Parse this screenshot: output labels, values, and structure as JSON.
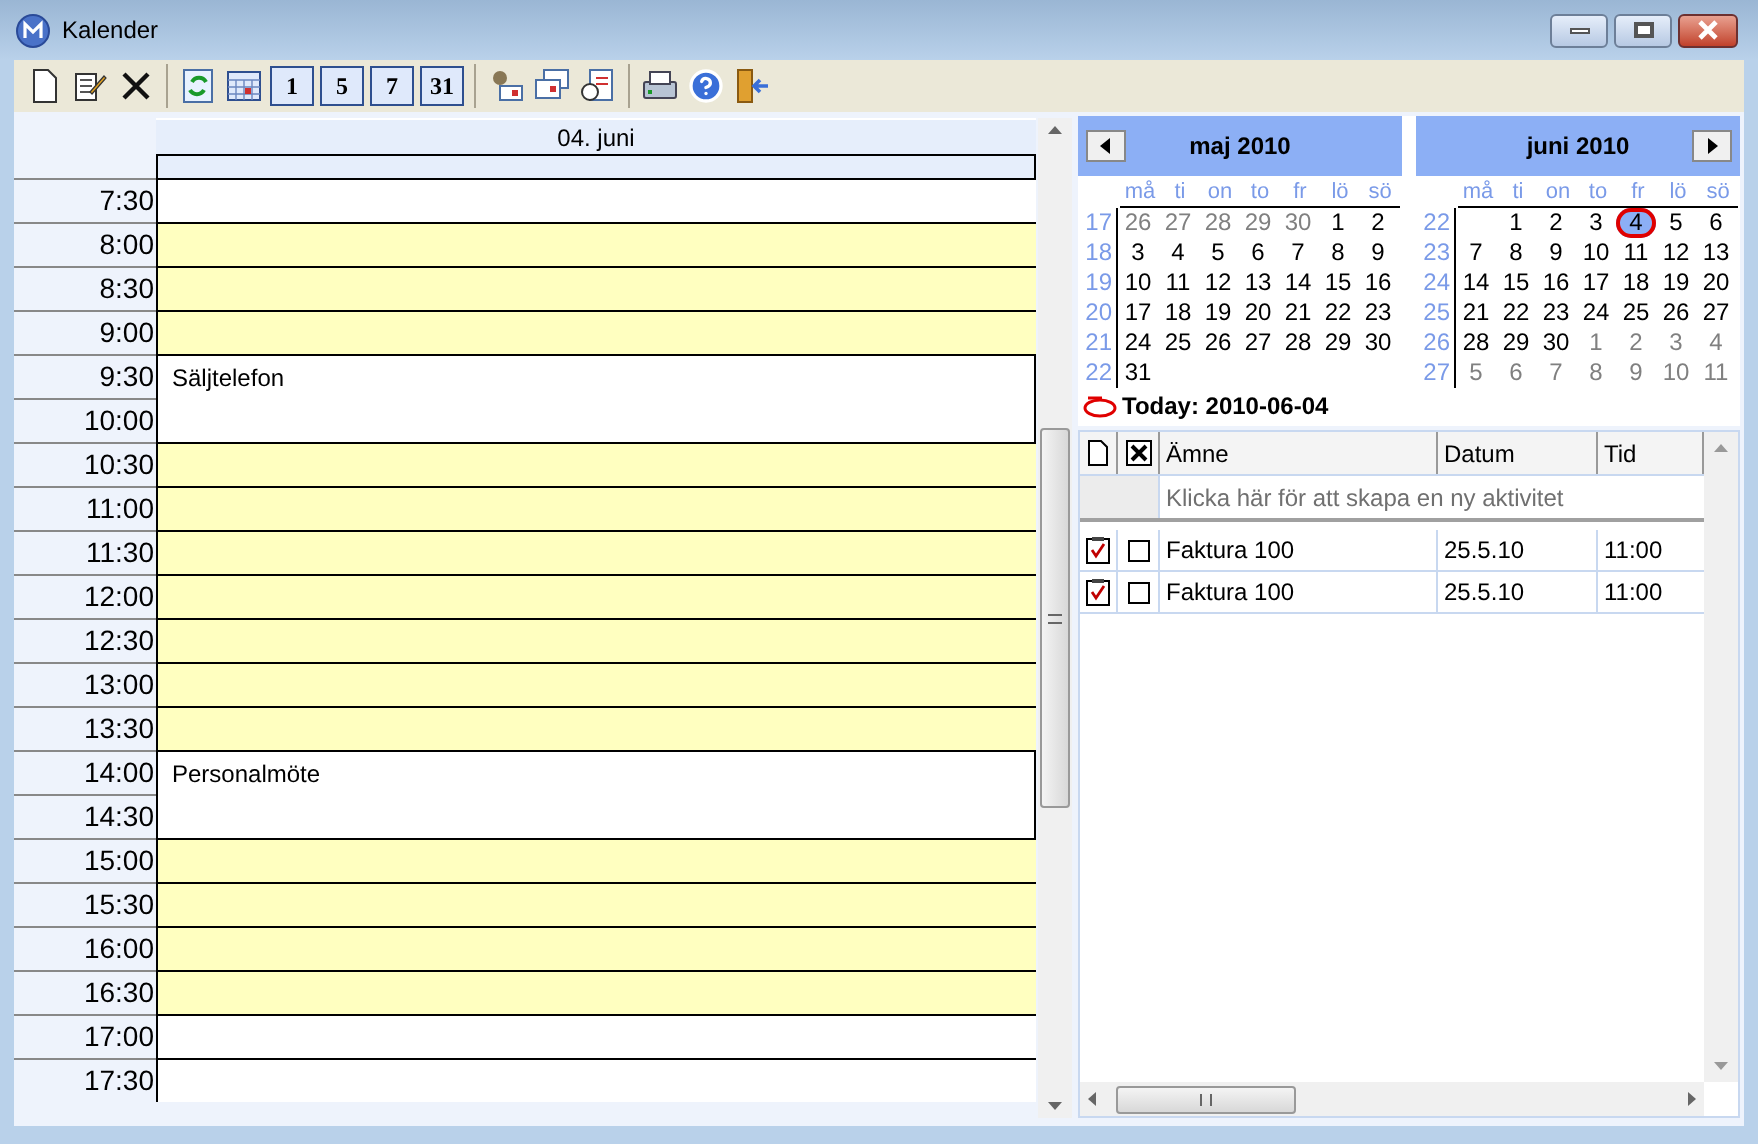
{
  "window": {
    "title": "Kalender"
  },
  "toolbar": [
    {
      "kind": "new"
    },
    {
      "kind": "edit"
    },
    {
      "kind": "delete"
    },
    {
      "kind": "separator"
    },
    {
      "kind": "refresh"
    },
    {
      "kind": "grid"
    },
    {
      "kind": "numbered",
      "label": "1"
    },
    {
      "kind": "numbered",
      "label": "5"
    },
    {
      "kind": "numbered",
      "label": "7"
    },
    {
      "kind": "numbered",
      "label": "31"
    },
    {
      "kind": "separator"
    },
    {
      "kind": "person"
    },
    {
      "kind": "windows"
    },
    {
      "kind": "clock"
    },
    {
      "kind": "separator"
    },
    {
      "kind": "print"
    },
    {
      "kind": "help"
    },
    {
      "kind": "exit"
    }
  ],
  "day_view": {
    "header": "04. juni",
    "rows": [
      {
        "kind": "slot",
        "time": "7:30",
        "working": false
      },
      {
        "kind": "slot",
        "time": "8:00",
        "working": true
      },
      {
        "kind": "slot",
        "time": "8:30",
        "working": true
      },
      {
        "kind": "slot",
        "time": "9:00",
        "working": true
      },
      {
        "kind": "appointment",
        "times": [
          "9:30",
          "10:00"
        ],
        "title": "Säljtelefon"
      },
      {
        "kind": "slot",
        "time": "10:30",
        "working": true
      },
      {
        "kind": "slot",
        "time": "11:00",
        "working": true
      },
      {
        "kind": "slot",
        "time": "11:30",
        "working": true
      },
      {
        "kind": "slot",
        "time": "12:00",
        "working": true
      },
      {
        "kind": "slot",
        "time": "12:30",
        "working": true
      },
      {
        "kind": "slot",
        "time": "13:00",
        "working": true
      },
      {
        "kind": "slot",
        "time": "13:30",
        "working": true
      },
      {
        "kind": "appointment",
        "times": [
          "14:00",
          "14:30"
        ],
        "title": "Personalmöte"
      },
      {
        "kind": "slot",
        "time": "15:00",
        "working": true
      },
      {
        "kind": "slot",
        "time": "15:30",
        "working": true
      },
      {
        "kind": "slot",
        "time": "16:00",
        "working": true
      },
      {
        "kind": "slot",
        "time": "16:30",
        "working": true
      },
      {
        "kind": "slot",
        "time": "17:00",
        "working": false
      },
      {
        "kind": "slot",
        "time": "17:30",
        "working": false
      }
    ]
  },
  "calendars": [
    {
      "title": "maj 2010",
      "weekdays": [
        "må",
        "ti",
        "on",
        "to",
        "fr",
        "lö",
        "sö"
      ],
      "weeks": [
        {
          "week": "17",
          "days": [
            {
              "d": "26",
              "muted": true,
              "selected": false
            },
            {
              "d": "27",
              "muted": true,
              "selected": false
            },
            {
              "d": "28",
              "muted": true,
              "selected": false
            },
            {
              "d": "29",
              "muted": true,
              "selected": false
            },
            {
              "d": "30",
              "muted": true,
              "selected": false
            },
            {
              "d": "1",
              "muted": false,
              "selected": false
            },
            {
              "d": "2",
              "muted": false,
              "selected": false
            }
          ]
        },
        {
          "week": "18",
          "days": [
            {
              "d": "3",
              "muted": false,
              "selected": false
            },
            {
              "d": "4",
              "muted": false,
              "selected": false
            },
            {
              "d": "5",
              "muted": false,
              "selected": false
            },
            {
              "d": "6",
              "muted": false,
              "selected": false
            },
            {
              "d": "7",
              "muted": false,
              "selected": false
            },
            {
              "d": "8",
              "muted": false,
              "selected": false
            },
            {
              "d": "9",
              "muted": false,
              "selected": false
            }
          ]
        },
        {
          "week": "19",
          "days": [
            {
              "d": "10",
              "muted": false,
              "selected": false
            },
            {
              "d": "11",
              "muted": false,
              "selected": false
            },
            {
              "d": "12",
              "muted": false,
              "selected": false
            },
            {
              "d": "13",
              "muted": false,
              "selected": false
            },
            {
              "d": "14",
              "muted": false,
              "selected": false
            },
            {
              "d": "15",
              "muted": false,
              "selected": false
            },
            {
              "d": "16",
              "muted": false,
              "selected": false
            }
          ]
        },
        {
          "week": "20",
          "days": [
            {
              "d": "17",
              "muted": false,
              "selected": false
            },
            {
              "d": "18",
              "muted": false,
              "selected": false
            },
            {
              "d": "19",
              "muted": false,
              "selected": false
            },
            {
              "d": "20",
              "muted": false,
              "selected": false
            },
            {
              "d": "21",
              "muted": false,
              "selected": false
            },
            {
              "d": "22",
              "muted": false,
              "selected": false
            },
            {
              "d": "23",
              "muted": false,
              "selected": false
            }
          ]
        },
        {
          "week": "21",
          "days": [
            {
              "d": "24",
              "muted": false,
              "selected": false
            },
            {
              "d": "25",
              "muted": false,
              "selected": false
            },
            {
              "d": "26",
              "muted": false,
              "selected": false
            },
            {
              "d": "27",
              "muted": false,
              "selected": false
            },
            {
              "d": "28",
              "muted": false,
              "selected": false
            },
            {
              "d": "29",
              "muted": false,
              "selected": false
            },
            {
              "d": "30",
              "muted": false,
              "selected": false
            }
          ]
        },
        {
          "week": "22",
          "days": [
            {
              "d": "31",
              "muted": false,
              "selected": false
            }
          ]
        }
      ]
    },
    {
      "title": "juni 2010",
      "weekdays": [
        "må",
        "ti",
        "on",
        "to",
        "fr",
        "lö",
        "sö"
      ],
      "weeks": [
        {
          "week": "22",
          "days": [
            {
              "d": "1",
              "muted": false,
              "selected": false
            },
            {
              "d": "2",
              "muted": false,
              "selected": false
            },
            {
              "d": "3",
              "muted": false,
              "selected": false
            },
            {
              "d": "4",
              "muted": false,
              "selected": true
            },
            {
              "d": "5",
              "muted": false,
              "selected": false
            },
            {
              "d": "6",
              "muted": false,
              "selected": false
            }
          ]
        },
        {
          "week": "23",
          "days": [
            {
              "d": "7",
              "muted": false,
              "selected": false
            },
            {
              "d": "8",
              "muted": false,
              "selected": false
            },
            {
              "d": "9",
              "muted": false,
              "selected": false
            },
            {
              "d": "10",
              "muted": false,
              "selected": false
            },
            {
              "d": "11",
              "muted": false,
              "selected": false
            },
            {
              "d": "12",
              "muted": false,
              "selected": false
            },
            {
              "d": "13",
              "muted": false,
              "selected": false
            }
          ]
        },
        {
          "week": "24",
          "days": [
            {
              "d": "14",
              "muted": false,
              "selected": false
            },
            {
              "d": "15",
              "muted": false,
              "selected": false
            },
            {
              "d": "16",
              "muted": false,
              "selected": false
            },
            {
              "d": "17",
              "muted": false,
              "selected": false
            },
            {
              "d": "18",
              "muted": false,
              "selected": false
            },
            {
              "d": "19",
              "muted": false,
              "selected": false
            },
            {
              "d": "20",
              "muted": false,
              "selected": false
            }
          ]
        },
        {
          "week": "25",
          "days": [
            {
              "d": "21",
              "muted": false,
              "selected": false
            },
            {
              "d": "22",
              "muted": false,
              "selected": false
            },
            {
              "d": "23",
              "muted": false,
              "selected": false
            },
            {
              "d": "24",
              "muted": false,
              "selected": false
            },
            {
              "d": "25",
              "muted": false,
              "selected": false
            },
            {
              "d": "26",
              "muted": false,
              "selected": false
            },
            {
              "d": "27",
              "muted": false,
              "selected": false
            }
          ]
        },
        {
          "week": "26",
          "days": [
            {
              "d": "28",
              "muted": false,
              "selected": false
            },
            {
              "d": "29",
              "muted": false,
              "selected": false
            },
            {
              "d": "30",
              "muted": false,
              "selected": false
            },
            {
              "d": "1",
              "muted": true,
              "selected": false
            },
            {
              "d": "2",
              "muted": true,
              "selected": false
            },
            {
              "d": "3",
              "muted": true,
              "selected": false
            },
            {
              "d": "4",
              "muted": true,
              "selected": false
            }
          ]
        },
        {
          "week": "27",
          "days": [
            {
              "d": "5",
              "muted": true,
              "selected": false
            },
            {
              "d": "6",
              "muted": true,
              "selected": false
            },
            {
              "d": "7",
              "muted": true,
              "selected": false
            },
            {
              "d": "8",
              "muted": true,
              "selected": false
            },
            {
              "d": "9",
              "muted": true,
              "selected": false
            },
            {
              "d": "10",
              "muted": true,
              "selected": false
            },
            {
              "d": "11",
              "muted": true,
              "selected": false
            }
          ]
        }
      ]
    }
  ],
  "today": "Today: 2010-06-04",
  "tasks": {
    "columns": [
      "Ämne",
      "Datum",
      "Tid"
    ],
    "new_row_placeholder": "Klicka här för att skapa en ny aktivitet",
    "rows": [
      {
        "subject": "Faktura 100",
        "date": "25.5.10",
        "time": "11:00",
        "done": false
      },
      {
        "subject": "Faktura 100",
        "date": "25.5.10",
        "time": "11:00",
        "done": false
      }
    ]
  }
}
